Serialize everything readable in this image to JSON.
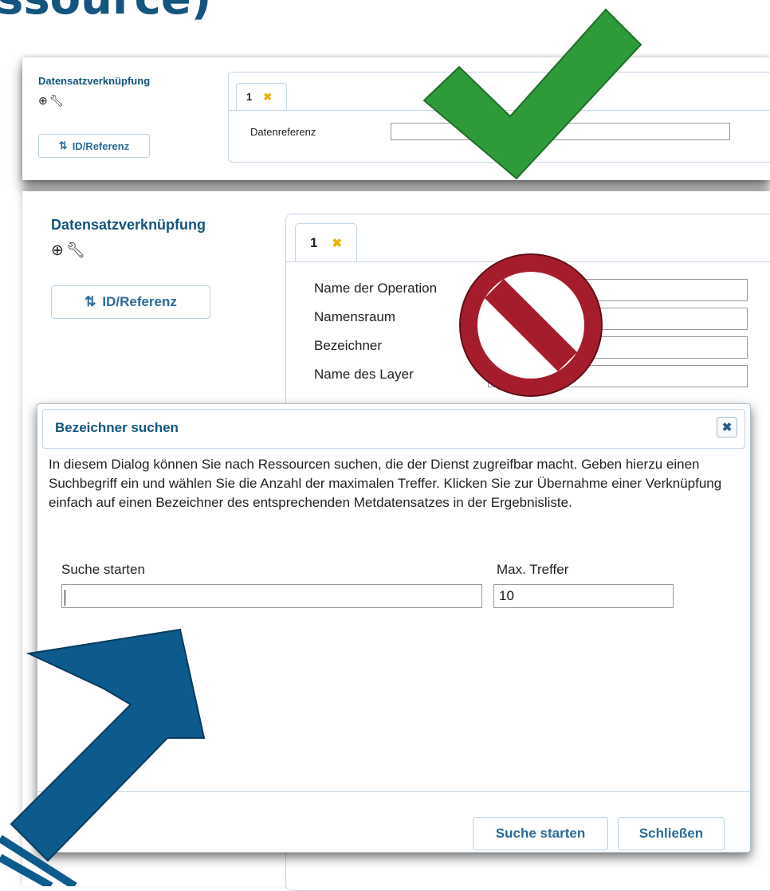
{
  "top_fragment": "ssource)",
  "panel_top": {
    "section_title": "Datensatzverknüpfung",
    "id_button": "ID/Referenz",
    "tab_label": "1",
    "field_label": "Datenreferenz"
  },
  "panel_bottom": {
    "section_title": "Datensatzverknüpfung",
    "id_button": "ID/Referenz",
    "tab_label": "1",
    "fields": [
      "Name der Operation",
      "Namensraum",
      "Bezeichner",
      "Name des Layer"
    ]
  },
  "dialog": {
    "title": "Bezeichner suchen",
    "description": "In diesem Dialog können Sie nach Ressourcen suchen, die der Dienst zugreifbar macht. Geben hierzu einen Suchbegriff ein und wählen Sie die Anzahl der maximalen Treffer. Klicken Sie zur Übernahme einer Verknüpfung einfach auf einen Bezeichner des entsprechenden Metdatensatzes in der Ergebnisliste.",
    "search_label": "Suche starten",
    "search_value": "",
    "max_label": "Max. Treffer",
    "max_value": "10",
    "search_button": "Suche starten",
    "close_button": "Schließen"
  },
  "colors": {
    "accent": "#14557f",
    "check": "#2f9a3a",
    "forbidden": "#a51d2d",
    "arrow": "#0d5a8c"
  }
}
